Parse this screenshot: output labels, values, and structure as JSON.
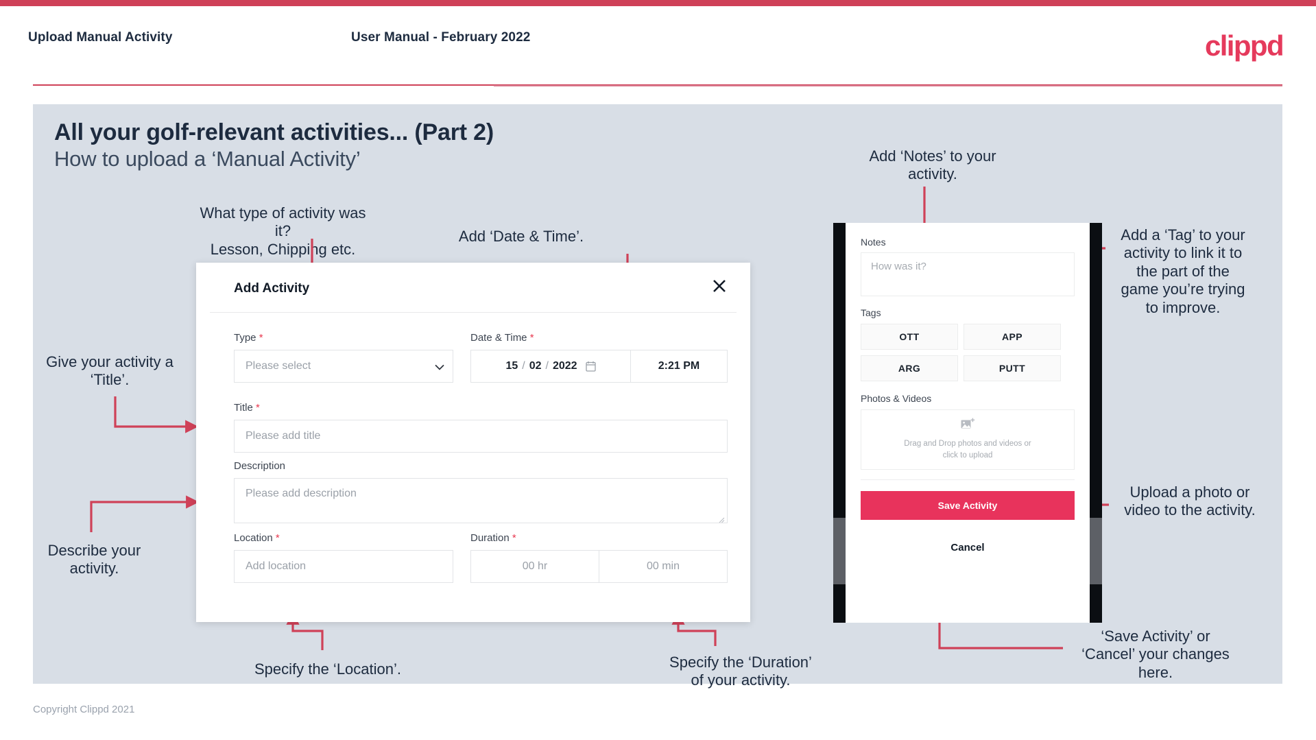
{
  "header": {
    "left_title": "Upload Manual Activity",
    "center_title": "User Manual - February 2022",
    "logo": "clippd"
  },
  "slide": {
    "title_main": "All your golf-relevant activities... (Part 2)",
    "title_sub": "How to upload a ‘Manual Activity’"
  },
  "footer": {
    "copyright": "Copyright Clippd 2021"
  },
  "dialog": {
    "title": "Add Activity",
    "close_icon": "close-icon",
    "type": {
      "label": "Type",
      "required": "*",
      "placeholder": "Please select",
      "chevron": "chevron-down-icon"
    },
    "datetime": {
      "label": "Date & Time",
      "required": "*",
      "day": "15",
      "month": "02",
      "year": "2022",
      "sep": "/",
      "calendar_icon": "calendar-icon",
      "time": "2:21 PM"
    },
    "title_field": {
      "label": "Title",
      "required": "*",
      "placeholder": "Please add title"
    },
    "description": {
      "label": "Description",
      "placeholder": "Please add description"
    },
    "location": {
      "label": "Location",
      "required": "*",
      "placeholder": "Add location"
    },
    "duration": {
      "label": "Duration",
      "required": "*",
      "hours": "00 hr",
      "minutes": "00 min"
    }
  },
  "phone": {
    "notes": {
      "label": "Notes",
      "placeholder": "How was it?"
    },
    "tags": {
      "label": "Tags",
      "items": [
        "OTT",
        "APP",
        "ARG",
        "PUTT"
      ]
    },
    "photos": {
      "label": "Photos & Videos",
      "icon": "add-image-icon",
      "line1": "Drag and Drop photos and videos or",
      "line2": "click to upload"
    },
    "save_label": "Save Activity",
    "cancel_label": "Cancel"
  },
  "annotations": {
    "type": "What type of activity was it?\nLesson, Chipping etc.",
    "datetime": "Add ‘Date & Time’.",
    "title": "Give your activity a\n‘Title’.",
    "description": "Describe your\nactivity.",
    "location": "Specify the ‘Location’.",
    "duration": "Specify the ‘Duration’\nof your activity.",
    "notes": "Add ‘Notes’ to your\nactivity.",
    "tags": "Add a ‘Tag’ to your\nactivity to link it to\nthe part of the\ngame you’re trying\nto improve.",
    "photos": "Upload a photo or\nvideo to the activity.",
    "save": "‘Save Activity’ or\n‘Cancel’ your changes\nhere."
  },
  "colors": {
    "accent": "#cf4158",
    "brand": "#e8335c",
    "slide_bg": "#d8dee6",
    "text_dark": "#1d2b3f"
  }
}
